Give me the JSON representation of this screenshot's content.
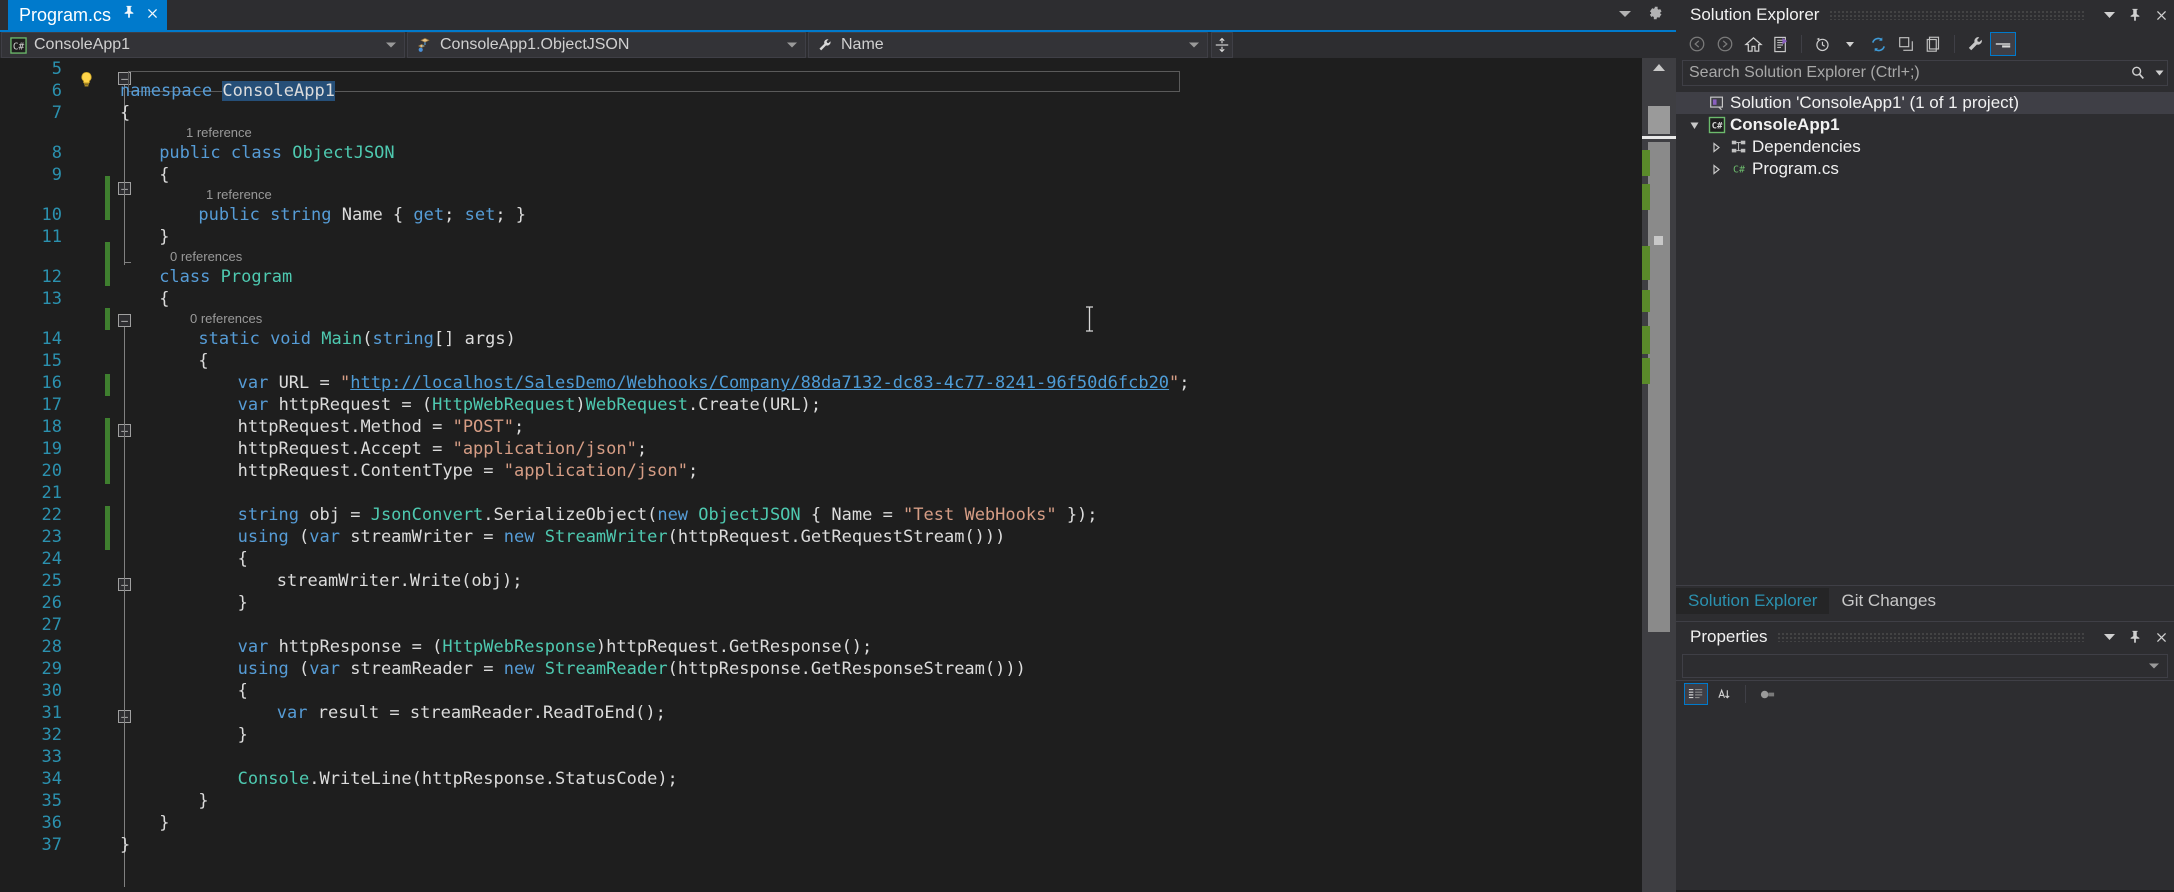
{
  "editor": {
    "tab": {
      "label": "Program.cs",
      "pin_icon": "pin-icon",
      "close_icon": "close-icon"
    },
    "tabstrip_right": {
      "dropdown_icon": "chevron-down-icon",
      "settings_icon": "gear-icon"
    },
    "navbar": {
      "project": "ConsoleApp1",
      "project_icon": "csharp-icon",
      "type": "ConsoleApp1.ObjectJSON",
      "type_icon": "class-icon",
      "member": "Name",
      "member_icon": "property-wrench-icon",
      "split_icon": "split-editor-icon"
    },
    "code_lines": [
      {
        "num": "5",
        "text": ""
      },
      {
        "num": "6",
        "text": "namespace ConsoleApp1"
      },
      {
        "num": "7",
        "text": "{"
      },
      {
        "num": "",
        "text": "1 reference",
        "kind": "codelens"
      },
      {
        "num": "8",
        "text": "    public class ObjectJSON"
      },
      {
        "num": "9",
        "text": "    {"
      },
      {
        "num": "",
        "text": "1 reference",
        "kind": "codelens"
      },
      {
        "num": "10",
        "text": "        public string Name { get; set; }"
      },
      {
        "num": "11",
        "text": "    }"
      },
      {
        "num": "",
        "text": "0 references",
        "kind": "codelens"
      },
      {
        "num": "12",
        "text": "    class Program"
      },
      {
        "num": "13",
        "text": "    {"
      },
      {
        "num": "",
        "text": "0 references",
        "kind": "codelens"
      },
      {
        "num": "14",
        "text": "        static void Main(string[] args)"
      },
      {
        "num": "15",
        "text": "        {"
      },
      {
        "num": "16",
        "text": "            var URL = \"http://localhost/SalesDemo/Webhooks/Company/88da7132-dc83-4c77-8241-96f50d6fcb20\";"
      },
      {
        "num": "17",
        "text": "            var httpRequest = (HttpWebRequest)WebRequest.Create(URL);"
      },
      {
        "num": "18",
        "text": "            httpRequest.Method = \"POST\";"
      },
      {
        "num": "19",
        "text": "            httpRequest.Accept = \"application/json\";"
      },
      {
        "num": "20",
        "text": "            httpRequest.ContentType = \"application/json\";"
      },
      {
        "num": "21",
        "text": ""
      },
      {
        "num": "22",
        "text": "            string obj = JsonConvert.SerializeObject(new ObjectJSON { Name = \"Test WebHooks\" });"
      },
      {
        "num": "23",
        "text": "            using (var streamWriter = new StreamWriter(httpRequest.GetRequestStream()))"
      },
      {
        "num": "24",
        "text": "            {"
      },
      {
        "num": "25",
        "text": "                streamWriter.Write(obj);"
      },
      {
        "num": "26",
        "text": "            }"
      },
      {
        "num": "27",
        "text": ""
      },
      {
        "num": "28",
        "text": "            var httpResponse = (HttpWebResponse)httpRequest.GetResponse();"
      },
      {
        "num": "29",
        "text": "            using (var streamReader = new StreamReader(httpResponse.GetResponseStream()))"
      },
      {
        "num": "30",
        "text": "            {"
      },
      {
        "num": "31",
        "text": "                var result = streamReader.ReadToEnd();"
      },
      {
        "num": "32",
        "text": "            }"
      },
      {
        "num": "33",
        "text": ""
      },
      {
        "num": "34",
        "text": "            Console.WriteLine(httpResponse.StatusCode);"
      },
      {
        "num": "35",
        "text": "        }"
      },
      {
        "num": "36",
        "text": "    }"
      },
      {
        "num": "37",
        "text": "}"
      }
    ],
    "url_string": "http://localhost/SalesDemo/Webhooks/Company/88da7132-dc83-4c77-8241-96f50d6fcb20",
    "selected_token": "ConsoleApp1",
    "lightbulb_icon": "lightbulb-icon"
  },
  "solution_explorer": {
    "title": "Solution Explorer",
    "header_buttons": [
      {
        "name": "dropdown",
        "icon": "chevron-down-icon"
      },
      {
        "name": "pin",
        "icon": "pin-icon"
      },
      {
        "name": "close",
        "icon": "close-icon"
      }
    ],
    "toolbar": [
      {
        "name": "back",
        "icon": "arrow-back-icon"
      },
      {
        "name": "forward",
        "icon": "arrow-forward-icon"
      },
      {
        "name": "home",
        "icon": "home-icon"
      },
      {
        "name": "pending-changes",
        "icon": "solution-filter-icon"
      },
      {
        "name": "history",
        "icon": "clock-icon"
      },
      {
        "name": "history-dropdown",
        "icon": "chevron-down-icon"
      },
      {
        "name": "refresh",
        "icon": "refresh-icon"
      },
      {
        "name": "collapse-all",
        "icon": "collapse-all-icon"
      },
      {
        "name": "show-all-files",
        "icon": "show-all-files-icon"
      },
      {
        "name": "properties",
        "icon": "wrench-icon"
      },
      {
        "name": "preview-selected-items",
        "icon": "preview-icon"
      }
    ],
    "search": {
      "placeholder": "Search Solution Explorer (Ctrl+;)",
      "value": "",
      "search_icon": "search-icon",
      "dropdown_icon": "chevron-down-icon"
    },
    "tree": [
      {
        "label": "Solution 'ConsoleApp1' (1 of 1 project)",
        "icon": "solution-icon",
        "indent": 1,
        "expander": "",
        "selected": true,
        "bold": false
      },
      {
        "label": "ConsoleApp1",
        "icon": "csharp-project-icon",
        "indent": 1,
        "expander": "expanded",
        "selected": false,
        "bold": true
      },
      {
        "label": "Dependencies",
        "icon": "dependencies-icon",
        "indent": 2,
        "expander": "collapsed",
        "selected": false,
        "bold": false
      },
      {
        "label": "Program.cs",
        "icon": "csharp-file-icon",
        "indent": 2,
        "expander": "collapsed",
        "selected": false,
        "bold": false
      }
    ],
    "bottom_tabs": [
      {
        "label": "Solution Explorer",
        "active": true
      },
      {
        "label": "Git Changes",
        "active": false
      }
    ]
  },
  "properties": {
    "title": "Properties",
    "header_buttons": [
      {
        "name": "dropdown",
        "icon": "chevron-down-icon"
      },
      {
        "name": "pin",
        "icon": "pin-icon"
      },
      {
        "name": "close",
        "icon": "close-icon"
      }
    ],
    "selector_value": "",
    "toolbar": [
      {
        "name": "categorized",
        "icon": "categorized-icon"
      },
      {
        "name": "alphabetical",
        "icon": "alphabetical-icon"
      },
      {
        "name": "properties-view",
        "icon": "properties-icon"
      },
      {
        "name": "events-view",
        "icon": "events-icon"
      }
    ]
  },
  "colors": {
    "accent": "#007acc",
    "keyword": "#569cd6",
    "type": "#4ec9b0",
    "string": "#d69d85",
    "plain": "#dcdcdc",
    "line_number": "#2b91af",
    "codelens": "#9a9a9a",
    "change_bar": "#3f7f2f",
    "editor_bg": "#1e1e1e",
    "chrome_bg": "#2d2d30"
  }
}
